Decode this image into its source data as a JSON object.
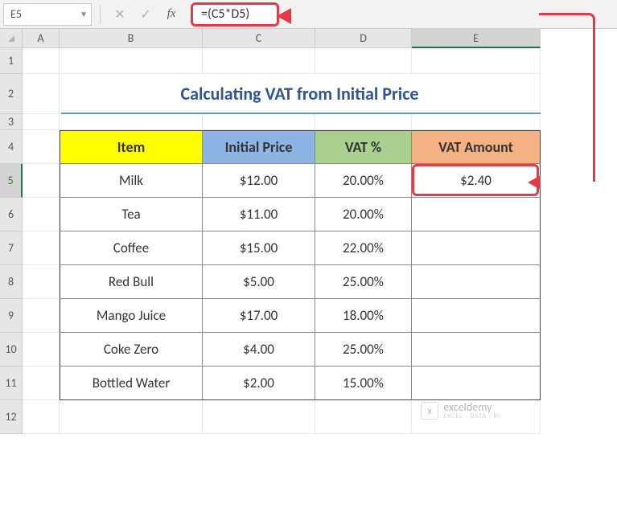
{
  "formula_bar": {
    "name_box": "E5",
    "fx_label": "fx",
    "formula": "=(C5*D5)"
  },
  "columns": {
    "A": "A",
    "B": "B",
    "C": "C",
    "D": "D",
    "E": "E"
  },
  "row_labels": [
    "1",
    "2",
    "3",
    "4",
    "5",
    "6",
    "7",
    "8",
    "9",
    "10",
    "11",
    "12"
  ],
  "title": "Calculating VAT from Initial Price",
  "headers": {
    "item": "Item",
    "initial_price": "Initial Price",
    "vat_pct": "VAT %",
    "vat_amount": "VAT Amount"
  },
  "rows": [
    {
      "item": "Milk",
      "price": "$12.00",
      "vat": "20.00%",
      "amount": "$2.40"
    },
    {
      "item": "Tea",
      "price": "$11.00",
      "vat": "20.00%",
      "amount": ""
    },
    {
      "item": "Coffee",
      "price": "$15.00",
      "vat": "22.00%",
      "amount": ""
    },
    {
      "item": "Red Bull",
      "price": "$5.00",
      "vat": "25.00%",
      "amount": ""
    },
    {
      "item": "Mango Juice",
      "price": "$17.00",
      "vat": "18.00%",
      "amount": ""
    },
    {
      "item": "Coke Zero",
      "price": "$4.00",
      "vat": "25.00%",
      "amount": ""
    },
    {
      "item": "Bottled Water",
      "price": "$2.00",
      "vat": "15.00%",
      "amount": ""
    }
  ],
  "watermark": {
    "brand": "exceldemy",
    "tag": "EXCEL · DATA · BI"
  },
  "chart_data": {
    "type": "table",
    "title": "Calculating VAT from Initial Price",
    "columns": [
      "Item",
      "Initial Price",
      "VAT %",
      "VAT Amount"
    ],
    "data": [
      [
        "Milk",
        12.0,
        0.2,
        2.4
      ],
      [
        "Tea",
        11.0,
        0.2,
        null
      ],
      [
        "Coffee",
        15.0,
        0.22,
        null
      ],
      [
        "Red Bull",
        5.0,
        0.25,
        null
      ],
      [
        "Mango Juice",
        17.0,
        0.18,
        null
      ],
      [
        "Coke Zero",
        4.0,
        0.25,
        null
      ],
      [
        "Bottled Water",
        2.0,
        0.15,
        null
      ]
    ],
    "formula_cell": {
      "ref": "E5",
      "formula": "=(C5*D5)"
    }
  }
}
